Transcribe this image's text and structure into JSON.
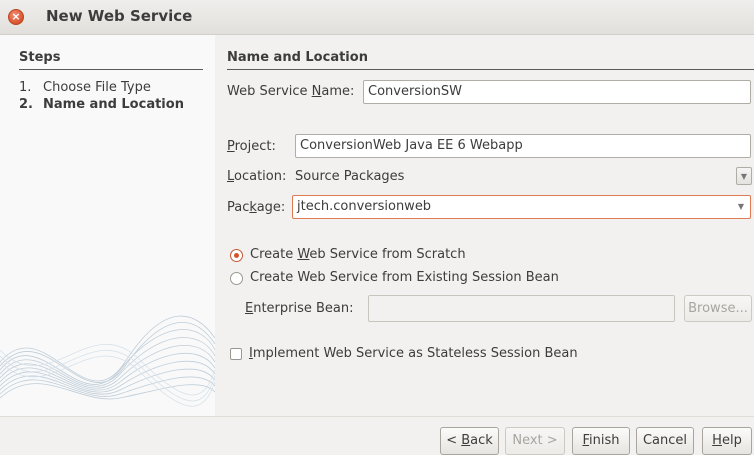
{
  "window": {
    "title": "New Web Service",
    "close_glyph": "×"
  },
  "steps": {
    "header": "Steps",
    "items": [
      {
        "num": "1.",
        "label": "Choose File Type"
      },
      {
        "num": "2.",
        "label": "Name and Location"
      }
    ]
  },
  "content": {
    "title": "Name and Location",
    "service_name": {
      "label_pre": "Web Service ",
      "label_mn": "N",
      "label_post": "ame:",
      "value": "ConversionSW"
    },
    "project": {
      "label_pre": "",
      "label_mn": "P",
      "label_post": "roject:",
      "value": "ConversionWeb Java EE 6 Webapp"
    },
    "location": {
      "label_pre": "",
      "label_mn": "L",
      "label_post": "ocation:",
      "value": "Source Packages"
    },
    "package": {
      "label_pre": "Pac",
      "label_mn": "k",
      "label_post": "age:",
      "value": "jtech.conversionweb"
    },
    "radio_scratch": {
      "pre": "Create ",
      "mn": "W",
      "post": "eb Service from Scratch"
    },
    "radio_session": {
      "text": "Create Web Service from Existing Session Bean"
    },
    "enterprise_bean": {
      "label_pre": "",
      "label_mn": "E",
      "label_post": "nterprise Bean:",
      "value": ""
    },
    "browse": "Browse...",
    "checkbox_stateless": {
      "pre": "",
      "mn": "I",
      "post": "mplement Web Service as Stateless Session Bean"
    }
  },
  "buttons": {
    "back": {
      "pre": "< ",
      "mn": "B",
      "post": "ack"
    },
    "next": "Next >",
    "finish": {
      "pre": "",
      "mn": "F",
      "post": "inish"
    },
    "cancel": "Cancel",
    "help": {
      "pre": "",
      "mn": "H",
      "post": "elp"
    }
  },
  "state": {
    "selected_radio": "scratch",
    "stateless_checked": false,
    "next_enabled": false,
    "browse_enabled": false
  },
  "icons": {
    "close": "close-icon",
    "dropdown": "chevron-down-icon"
  },
  "colors": {
    "accent": "#d4532a",
    "focus_border": "#e07a55",
    "steps_bg": "#f9f9f9",
    "window_bg": "#f2f1f0"
  }
}
